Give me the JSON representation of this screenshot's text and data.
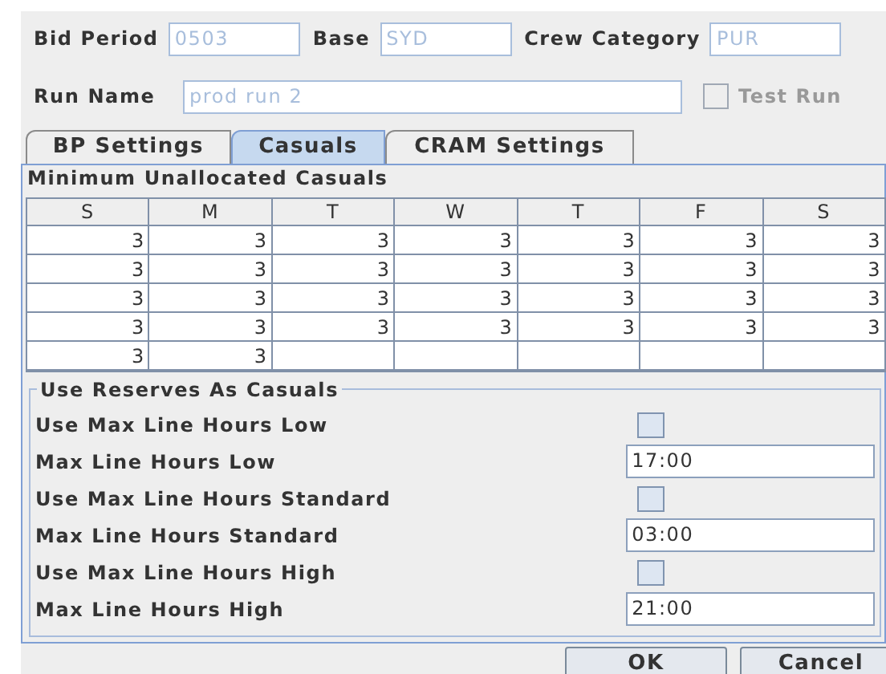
{
  "header": {
    "fields": [
      {
        "label": "Bid Period",
        "value": "0503",
        "disabled": true
      },
      {
        "label": "Base",
        "value": "SYD",
        "disabled": true
      },
      {
        "label": "Crew Category",
        "value": "PUR",
        "disabled": true
      }
    ],
    "run_name": {
      "label": "Run Name",
      "value": "prod run 2",
      "disabled": true
    },
    "test_run": {
      "label": "Test Run",
      "checked": false,
      "disabled": true
    }
  },
  "tabs": [
    {
      "label": "BP Settings",
      "selected": false
    },
    {
      "label": "Casuals",
      "selected": true
    },
    {
      "label": "CRAM Settings",
      "selected": false
    }
  ],
  "casuals_table": {
    "title": "Minimum Unallocated Casuals",
    "columns": [
      "S",
      "M",
      "T",
      "W",
      "T",
      "F",
      "S"
    ],
    "rows": [
      [
        "3",
        "3",
        "3",
        "3",
        "3",
        "3",
        "3"
      ],
      [
        "3",
        "3",
        "3",
        "3",
        "3",
        "3",
        "3"
      ],
      [
        "3",
        "3",
        "3",
        "3",
        "3",
        "3",
        "3"
      ],
      [
        "3",
        "3",
        "3",
        "3",
        "3",
        "3",
        "3"
      ],
      [
        "3",
        "3"
      ]
    ]
  },
  "reserves": {
    "title": "Use Reserves As Casuals",
    "rows": [
      {
        "kind": "checkbox",
        "label": "Use Max Line Hours Low",
        "checked": false
      },
      {
        "kind": "field",
        "label": "Max Line Hours Low",
        "value": "17:00"
      },
      {
        "kind": "checkbox",
        "label": "Use Max Line Hours Standard",
        "checked": false
      },
      {
        "kind": "field",
        "label": "Max Line Hours Standard",
        "value": "03:00"
      },
      {
        "kind": "checkbox",
        "label": "Use Max Line Hours High",
        "checked": false
      },
      {
        "kind": "field",
        "label": "Max Line Hours High",
        "value": "21:00"
      }
    ]
  },
  "buttons": [
    "OK",
    "Cancel"
  ]
}
